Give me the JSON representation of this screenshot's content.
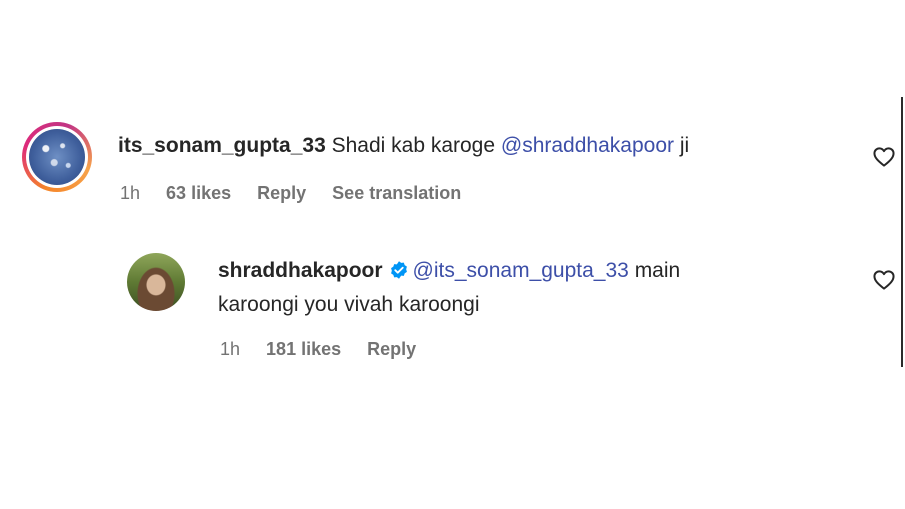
{
  "comments": [
    {
      "username": "its_sonam_gupta_33",
      "text_before": "Shadi kab karoge",
      "mention": "@shraddhakapoor",
      "text_after": "ji",
      "time": "1h",
      "likes": "63 likes",
      "reply_label": "Reply",
      "translation_label": "See translation"
    },
    {
      "username": "shraddhakapoor",
      "verified": true,
      "mention": "@its_sonam_gupta_33",
      "text_line1_after": "main",
      "text_line2": "karoongi you vivah karoongi",
      "time": "1h",
      "likes": "181 likes",
      "reply_label": "Reply"
    }
  ],
  "icons": {
    "like": "heart-outline-icon",
    "verified": "verified-badge-icon"
  },
  "colors": {
    "mention": "#3d4fa8",
    "verified": "#0095f6",
    "meta": "#737373"
  }
}
